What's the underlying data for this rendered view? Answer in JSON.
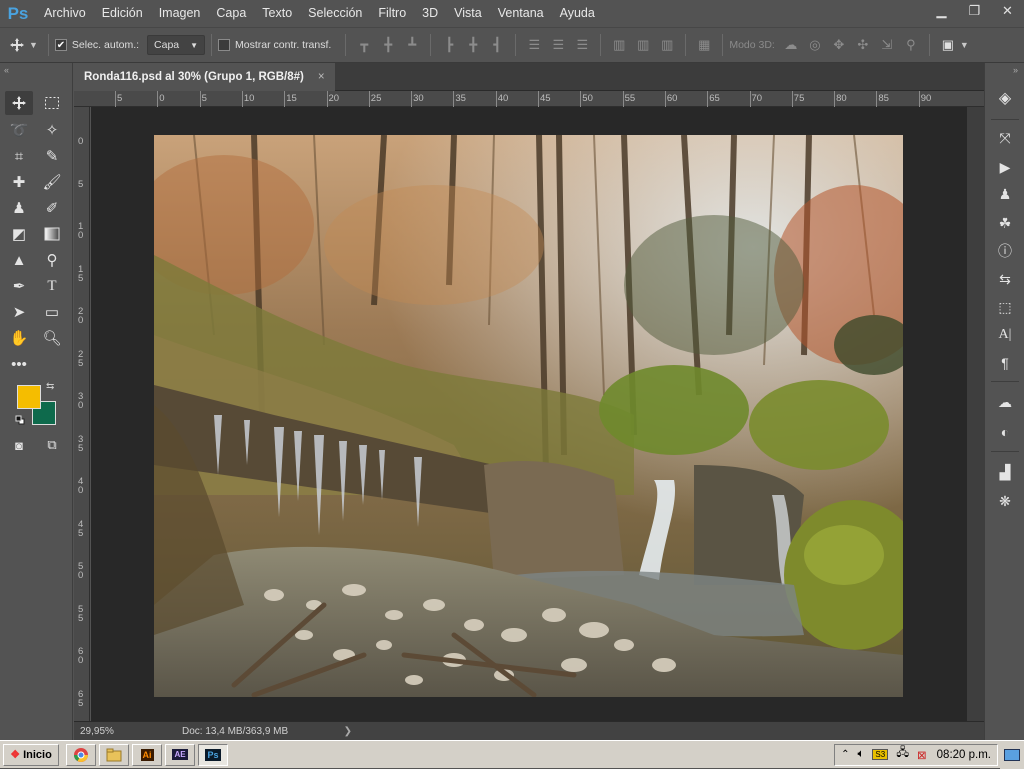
{
  "app": {
    "logo": "Ps",
    "accent": "#4aa3e0"
  },
  "menu": [
    "Archivo",
    "Edición",
    "Imagen",
    "Capa",
    "Texto",
    "Selección",
    "Filtro",
    "3D",
    "Vista",
    "Ventana",
    "Ayuda"
  ],
  "window_controls": {
    "minimize": "▁",
    "restore": "❐",
    "close": "✕"
  },
  "options": {
    "auto_select_label": "Selec. autom.:",
    "auto_select_checked": true,
    "target_value": "Capa",
    "show_transform_label": "Mostrar contr. transf.",
    "show_transform_checked": false,
    "mode3d_label": "Modo 3D:"
  },
  "document": {
    "tab_title": "Ronda116.psd al 30% (Grupo 1, RGB/8#)",
    "tab_close": "×",
    "zoom": "29,95%",
    "doc_info": "Doc: 13,4 MB/363,9 MB",
    "ruler_top": [
      "5",
      "0",
      "5",
      "10",
      "15",
      "20",
      "25",
      "30",
      "35",
      "40",
      "45",
      "50",
      "55",
      "60",
      "65",
      "70",
      "75",
      "80",
      "85",
      "90"
    ],
    "ruler_left": [
      "0",
      "5",
      "1 0",
      "1 5",
      "2 0",
      "2 5",
      "3 0",
      "3 5",
      "4 0",
      "4 5",
      "5 0",
      "5 5",
      "6 0",
      "6 5"
    ]
  },
  "colors": {
    "foreground": "#f5bd00",
    "background": "#0e6a4c"
  },
  "taskbar": {
    "start_label": "Inicio",
    "apps": [
      "chrome-icon",
      "explorer-icon",
      "illustrator-icon",
      "after-effects-icon",
      "photoshop-icon"
    ],
    "app_glyphs": {
      "ai": "Ai",
      "ae": "AE",
      "ps": "Ps"
    },
    "clock": "08:20 p.m."
  }
}
